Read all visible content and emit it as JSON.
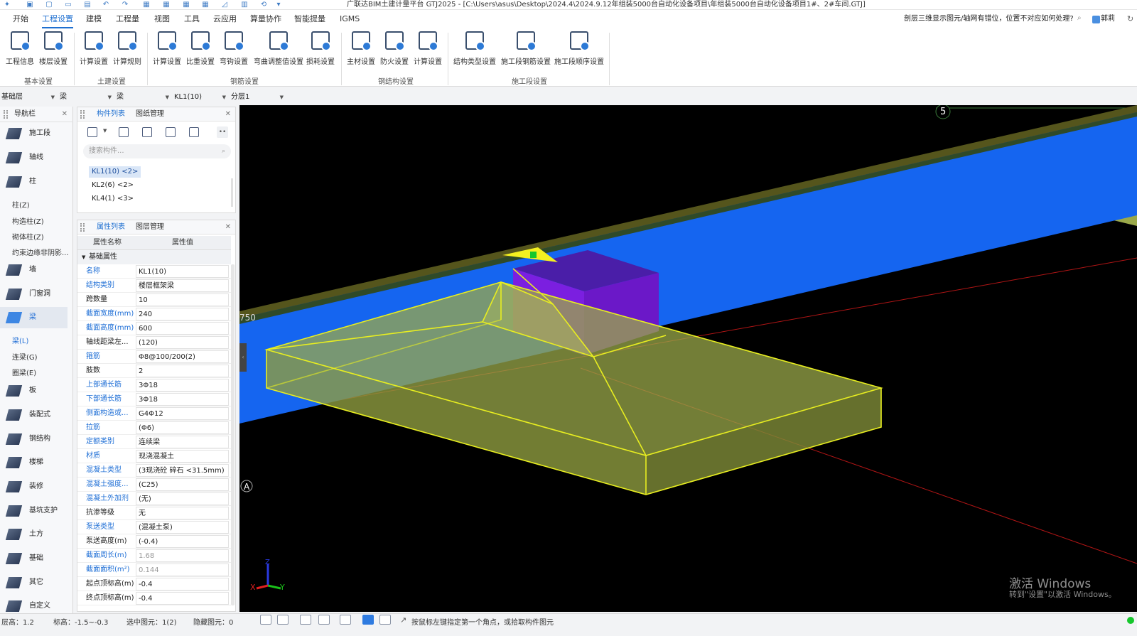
{
  "titlebar": {
    "title": "广联达BIM土建计量平台 GTJ2025 - [C:\\Users\\asus\\Desktop\\2024.4\\2024.9.12年组装5000台自动化设备项目\\年组装5000台自动化设备项目1#、2#车间.GTJ]"
  },
  "menu": {
    "items": [
      "开始",
      "工程设置",
      "建模",
      "工程量",
      "视图",
      "工具",
      "云应用",
      "算量协作",
      "智能提量",
      "IGMS"
    ],
    "active": "工程设置",
    "help_question": "剖层三维显示图元/轴网有错位，位置不对应如何处理?",
    "user": "郭莉"
  },
  "ribbon": {
    "buttons": [
      "工程信息",
      "楼层设置",
      "计算设置",
      "计算规则",
      "计算设置",
      "比重设置",
      "弯钩设置",
      "弯曲调整值设置",
      "损耗设置",
      "主材设置",
      "防火设置",
      "计算设置",
      "结构类型设置",
      "施工段钢筋设置",
      "施工段顺序设置"
    ],
    "groups": [
      "基本设置",
      "土建设置",
      "钢筋设置",
      "钢结构设置",
      "施工段设置"
    ]
  },
  "selectors": [
    "基础层",
    "梁",
    "梁",
    "KL1(10)",
    "分层1"
  ],
  "nav": {
    "title": "导航栏",
    "items": [
      "施工段",
      "轴线",
      "柱",
      "墙",
      "门窗洞",
      "梁",
      "板",
      "装配式",
      "钢结构",
      "楼梯",
      "装修",
      "基坑支护",
      "土方",
      "基础",
      "其它",
      "自定义"
    ],
    "sub_column": [
      "柱(Z)",
      "构造柱(Z)",
      "砌体柱(Z)",
      "约束边缘非阴影..."
    ],
    "sub_beam": [
      "梁(L)",
      "连梁(G)",
      "圈梁(E)"
    ]
  },
  "component_panel": {
    "tabs": [
      "构件列表",
      "图纸管理"
    ],
    "search_placeholder": "搜索构件...",
    "items": [
      "KL1(10) <2>",
      "KL2(6) <2>",
      "KL4(1) <3>"
    ]
  },
  "property_panel": {
    "tabs": [
      "属性列表",
      "图层管理"
    ],
    "col_name": "属性名称",
    "col_value": "属性值",
    "group": "基础属性",
    "rows": [
      {
        "name": "名称",
        "value": "KL1(10)",
        "blue": true
      },
      {
        "name": "结构类别",
        "value": "楼层框架梁",
        "blue": true
      },
      {
        "name": "跨数量",
        "value": "10",
        "blue": false
      },
      {
        "name": "截面宽度(mm)",
        "value": "240",
        "blue": true
      },
      {
        "name": "截面高度(mm)",
        "value": "600",
        "blue": true
      },
      {
        "name": "轴线距梁左...",
        "value": "(120)",
        "blue": false
      },
      {
        "name": "箍筋",
        "value": "Φ8@100/200(2)",
        "blue": true
      },
      {
        "name": "肢数",
        "value": "2",
        "blue": false
      },
      {
        "name": "上部通长筋",
        "value": "3Φ18",
        "blue": true
      },
      {
        "name": "下部通长筋",
        "value": "3Φ18",
        "blue": true
      },
      {
        "name": "侧面构造或...",
        "value": "G4Φ12",
        "blue": true
      },
      {
        "name": "拉筋",
        "value": "(Φ6)",
        "blue": true
      },
      {
        "name": "定额类别",
        "value": "连续梁",
        "blue": true
      },
      {
        "name": "材质",
        "value": "现浇混凝土",
        "blue": true
      },
      {
        "name": "混凝土类型",
        "value": "(3现浇砼 碎石 <31.5mm)",
        "blue": true
      },
      {
        "name": "混凝土强度...",
        "value": "(C25)",
        "blue": true
      },
      {
        "name": "混凝土外加剂",
        "value": "(无)",
        "blue": true
      },
      {
        "name": "抗渗等级",
        "value": "无",
        "blue": false
      },
      {
        "name": "泵送类型",
        "value": "(混凝土泵)",
        "blue": true
      },
      {
        "name": "泵送高度(m)",
        "value": "(-0.4)",
        "blue": false
      },
      {
        "name": "截面周长(m)",
        "value": "1.68",
        "blue": true,
        "gray": true
      },
      {
        "name": "截面面积(m²)",
        "value": "0.144",
        "blue": true,
        "gray": true
      },
      {
        "name": "起点顶标高(m)",
        "value": "-0.4",
        "blue": false
      },
      {
        "name": "终点顶标高(m)",
        "value": "-0.4",
        "blue": false
      }
    ]
  },
  "viewport": {
    "axis_label_5": "5",
    "axis_label_a": "A",
    "dim_text": "750",
    "gizmo": {
      "x": "X",
      "y": "Y",
      "z": "Z"
    },
    "colors": {
      "beam": "#1565f0",
      "beam_top": "#5a5a1e",
      "column": "#7b1fe0",
      "footing": "#9aa84a",
      "edge": "#e8ee20"
    }
  },
  "watermark": {
    "line1": "激活 Windows",
    "line2": "转到\"设置\"以激活 Windows。"
  },
  "status": {
    "floor": "层高：1.2",
    "elevation": "标高：-1.5~-0.3",
    "selected": "选中图元：1(2)",
    "hidden": "隐藏图元：0",
    "hint": "按鼠标左键指定第一个角点，或拾取构件图元"
  }
}
